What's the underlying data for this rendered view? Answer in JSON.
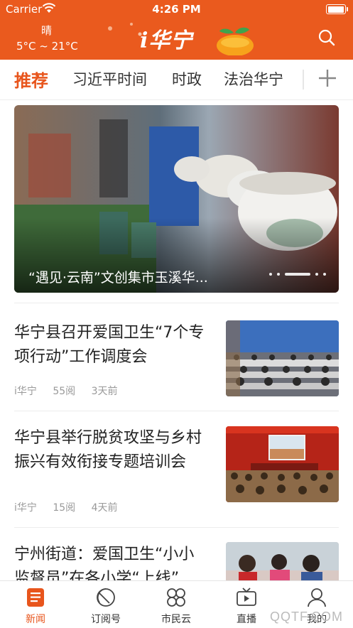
{
  "status_bar": {
    "carrier": "Carrier",
    "time": "4:26 PM"
  },
  "header": {
    "weather_condition": "晴",
    "weather_temp": "5°C ~ 21°C",
    "logo_text": "i华宁",
    "search_icon": "search-icon",
    "brand_color": "#ea5a1e"
  },
  "tabs": [
    {
      "label": "推荐",
      "active": true
    },
    {
      "label": "习近平时间",
      "active": false
    },
    {
      "label": "时政",
      "active": false
    },
    {
      "label": "法治华宁",
      "active": false
    }
  ],
  "add_channel_icon": "plus-icon",
  "hero": {
    "caption": "“遇见·云南”文创集市玉溪华...",
    "dots_count": 6,
    "active_dot": 3
  },
  "news": [
    {
      "title": "华宁县召开爱国卫生“7个专项行动”工作调度会",
      "source": "i华宁",
      "reads": "55阅",
      "time": "3天前"
    },
    {
      "title": "华宁县举行脱贫攻坚与乡村振兴有效衔接专题培训会",
      "source": "i华宁",
      "reads": "15阅",
      "time": "4天前"
    },
    {
      "title": "宁州街道：爱国卫生“小小监督员”在各小学“上线”",
      "source": "",
      "reads": "",
      "time": ""
    }
  ],
  "bottom_nav": [
    {
      "label": "新闻",
      "icon": "news-icon",
      "active": true
    },
    {
      "label": "订阅号",
      "icon": "subscribe-icon",
      "active": false
    },
    {
      "label": "市民云",
      "icon": "citizen-cloud-icon",
      "active": false
    },
    {
      "label": "直播",
      "icon": "live-tv-icon",
      "active": false
    },
    {
      "label": "我的",
      "icon": "user-icon",
      "active": false
    }
  ],
  "watermark": "QQTF.COM",
  "accent_color": "#e8551c"
}
